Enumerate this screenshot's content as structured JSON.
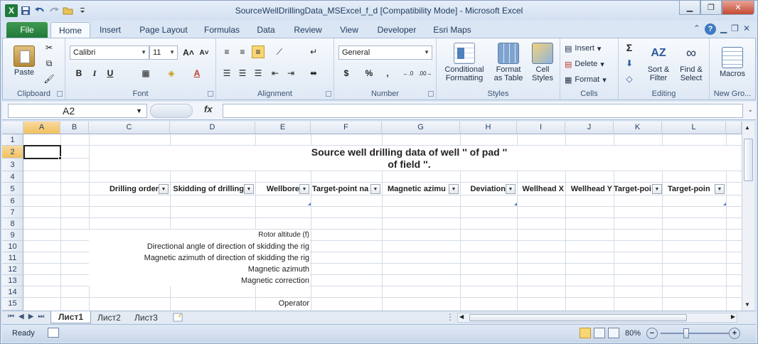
{
  "window": {
    "title": "SourceWellDrillingData_MSExcel_f_d  [Compatibility Mode]  -  Microsoft Excel",
    "logo": "X"
  },
  "tabs": [
    "File",
    "Home",
    "Insert",
    "Page Layout",
    "Formulas",
    "Data",
    "Review",
    "View",
    "Developer",
    "Esri Maps"
  ],
  "ribbon": {
    "clipboard": {
      "label": "Clipboard",
      "paste": "Paste"
    },
    "font": {
      "label": "Font",
      "name": "Calibri",
      "size": "11",
      "grow": "A",
      "shrink": "A",
      "bold": "B",
      "italic": "I",
      "underline": "U",
      "fontcolor": "A"
    },
    "alignment": {
      "label": "Alignment"
    },
    "number": {
      "label": "Number",
      "format": "General",
      "currency": "$",
      "percent": "%",
      "comma": ",",
      "incdec": ".0 .00",
      "decdec": ".00 .0"
    },
    "styles": {
      "label": "Styles",
      "conditional": "Conditional",
      "conditional2": "Formatting",
      "table": "Format",
      "table2": "as Table",
      "cell": "Cell",
      "cell2": "Styles"
    },
    "cells": {
      "label": "Cells",
      "insert": "Insert",
      "delete": "Delete",
      "format": "Format"
    },
    "editing": {
      "label": "Editing",
      "sigma": "Σ",
      "sort": "Sort &",
      "sort2": "Filter",
      "find": "Find &",
      "find2": "Select"
    },
    "macros": {
      "label": "New Gro...",
      "macros": "Macros"
    }
  },
  "formula_bar": {
    "name_box": "A2",
    "fx": "fx",
    "content": ""
  },
  "columns": [
    "A",
    "B",
    "C",
    "D",
    "E",
    "F",
    "G",
    "H",
    "I",
    "J",
    "K",
    "L"
  ],
  "rows": [
    "1",
    "2",
    "3",
    "4",
    "5",
    "6",
    "7",
    "8",
    "9",
    "10",
    "11",
    "12",
    "13",
    "14",
    "15"
  ],
  "sheet": {
    "title1": "Source well drilling data of well '' of pad ''",
    "title2": "of field ''.",
    "headers": [
      "Drilling order",
      "Skidding of drilling",
      "Wellbore",
      "Target-point na",
      "Magnetic azimu",
      "Deviation",
      "Wellhead X",
      "Wellhead Y",
      "Target-poi",
      "Target-poin"
    ],
    "labels": {
      "r9": "Rotor altitude (f)",
      "r10": "Directional angle of direction of skidding the rig",
      "r11": "Magnetic azimuth of direction of skidding the rig",
      "r12": "Magnetic azimuth",
      "r13": "Magnetic correction",
      "r15": "Operator"
    }
  },
  "sheet_tabs": [
    "Лист1",
    "Лист2",
    "Лист3"
  ],
  "status": {
    "ready": "Ready",
    "zoom": "80%"
  }
}
